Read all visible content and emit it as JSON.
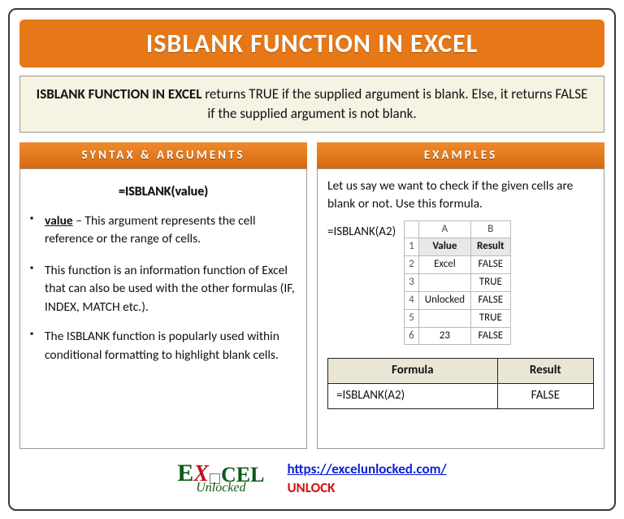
{
  "title": "ISBLANK FUNCTION IN EXCEL",
  "description": {
    "lead": "ISBLANK FUNCTION IN EXCEL",
    "rest": " returns TRUE if the supplied argument is blank. Else, it returns FALSE if the supplied argument is not blank."
  },
  "left": {
    "header": "SYNTAX & ARGUMENTS",
    "syntax": "=ISBLANK(value)",
    "arg_name": "value",
    "arg_desc": " – This argument represents the cell reference or the range of cells.",
    "bullets": [
      "This function is an information function of Excel that can also be used with the other formulas (IF, INDEX, MATCH etc.).",
      "The ISBLANK function is popularly used within conditional formatting to highlight blank cells."
    ]
  },
  "right": {
    "header": "EXAMPLES",
    "intro": "Let us say we want to check if the given cells are blank or not. Use this formula.",
    "formula": "=ISBLANK(A2)",
    "sheet": {
      "cols": [
        "A",
        "B"
      ],
      "headers": [
        "Value",
        "Result"
      ],
      "rows": [
        {
          "n": "2",
          "value": "Excel",
          "result": "FALSE"
        },
        {
          "n": "3",
          "value": "",
          "result": "TRUE"
        },
        {
          "n": "4",
          "value": "Unlocked",
          "result": "FALSE"
        },
        {
          "n": "5",
          "value": "",
          "result": "TRUE"
        },
        {
          "n": "6",
          "value": "23",
          "result": "FALSE"
        }
      ]
    },
    "result_table": {
      "h1": "Formula",
      "h2": "Result",
      "formula": "=ISBLANK(A2)",
      "result": "FALSE"
    }
  },
  "footer": {
    "logo_e": "E",
    "logo_x": "X",
    "logo_rest": "CEL",
    "logo_sub": "Unlocked",
    "url": "https://excelunlocked.com/",
    "unlock": "UNLOCK"
  }
}
